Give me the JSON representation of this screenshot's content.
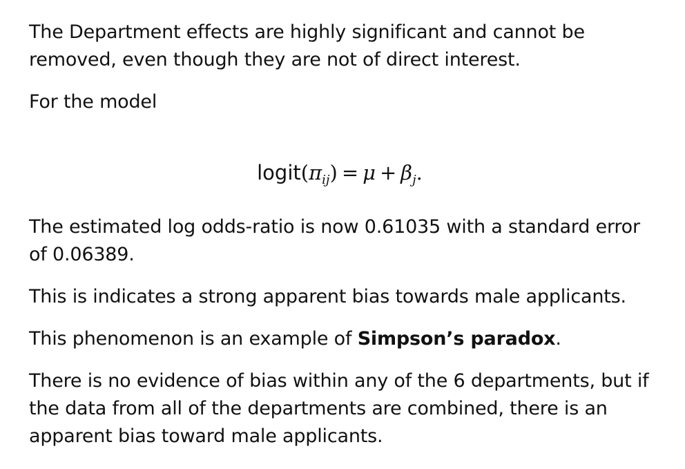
{
  "slide": {
    "para1": {
      "lines": [
        "The Department effects are highly significant and cannot be",
        "removed, even though they are not of direct interest."
      ]
    },
    "para2": "For the model",
    "equation": {
      "fn": "logit",
      "open": "(",
      "pi": "π",
      "sub": "ij",
      "close": ")",
      "equals": "=",
      "mu": "μ",
      "plus": "+",
      "beta": "β",
      "beta_sub": "j",
      "end": "."
    },
    "para3": {
      "lines": [
        "The estimated log odds-ratio is now 0.61035 with a standard error",
        "of 0.06389."
      ]
    },
    "para4": "This is indicates a strong apparent bias towards male applicants.",
    "para5": {
      "before": "This phenomenon is an example of ",
      "bold": "Simpson’s paradox",
      "after": "."
    },
    "para6": {
      "lines": [
        "There is no evidence of bias within any of the 6 departments, but if",
        "the data from all of the departments are combined, there is an",
        "apparent bias toward male applicants."
      ]
    }
  }
}
